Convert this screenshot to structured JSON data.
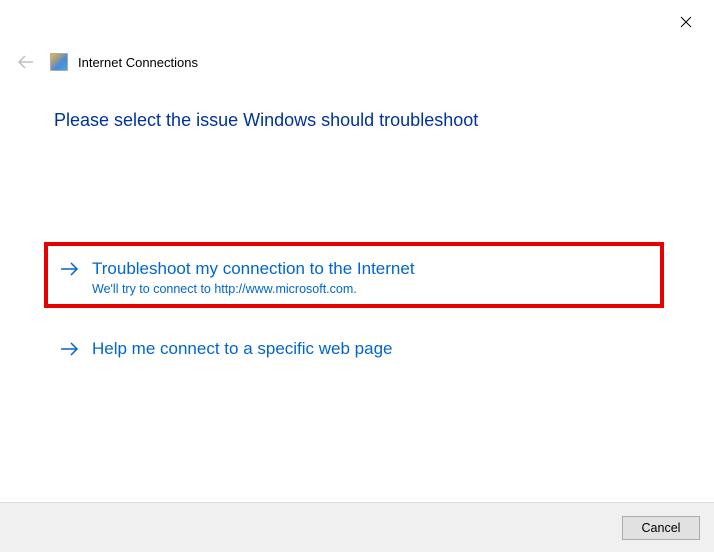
{
  "window": {
    "title": "Internet Connections"
  },
  "heading": "Please select the issue Windows should troubleshoot",
  "options": [
    {
      "title": "Troubleshoot my connection to the Internet",
      "subtitle": "We'll try to connect to http://www.microsoft.com."
    },
    {
      "title": "Help me connect to a specific web page"
    }
  ],
  "footer": {
    "cancel_label": "Cancel"
  }
}
